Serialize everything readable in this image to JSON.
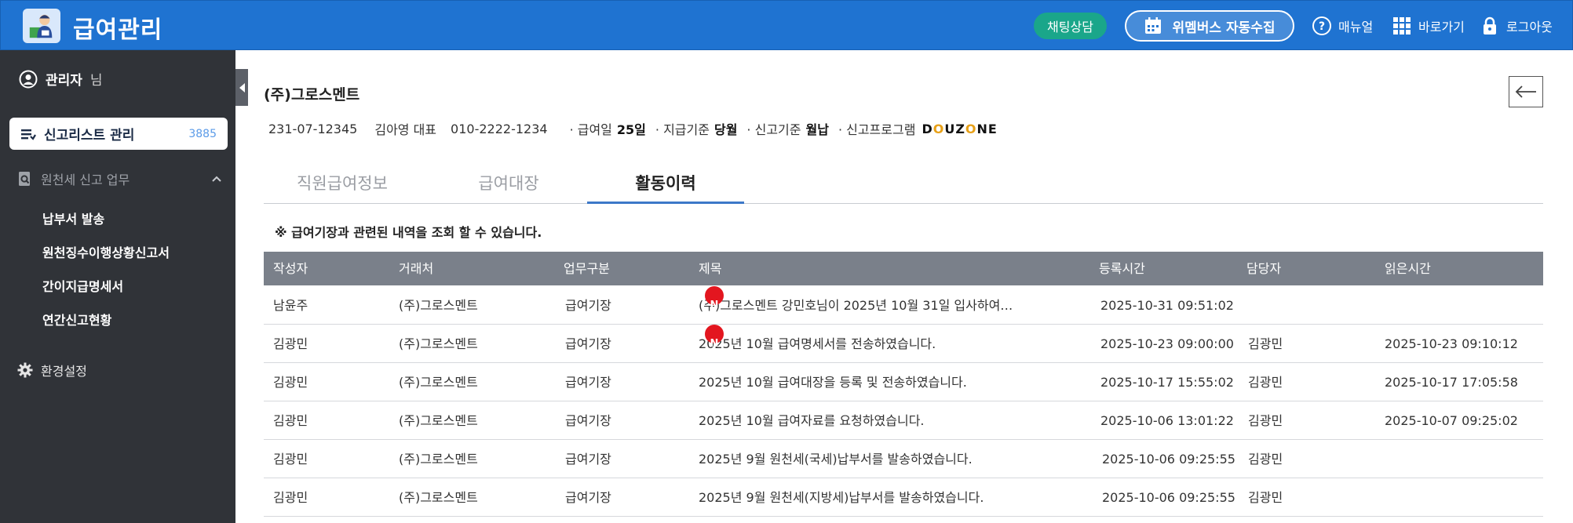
{
  "header": {
    "app_title": "급여관리",
    "chat_button": "채팅상담",
    "collect_button": "위멤버스 자동수집",
    "manual_link": "매뉴얼",
    "shortcut_link": "바로가기",
    "logout_link": "로그아웃",
    "brand_color": "#1f73d1"
  },
  "sidebar": {
    "admin_name": "관리자",
    "admin_suffix": "님",
    "active_menu": {
      "label": "신고리스트 관리",
      "count": "3885"
    },
    "section": {
      "label": "원천세 신고 업무",
      "expanded": true
    },
    "sub_items": [
      "납부서 발송",
      "원천징수이행상황신고서",
      "간이지급명세서",
      "연간신고현황"
    ],
    "settings": "환경설정"
  },
  "company": {
    "name": "(주)그로스멘트",
    "biz_no": "231-07-12345",
    "ceo": "김아영 대표",
    "phone": "010-2222-1234",
    "pay_day_label": "· 급여일",
    "pay_day_value": "25일",
    "pay_basis_label": "· 지급기준",
    "pay_basis_value": "당월",
    "report_basis_label": "· 신고기준",
    "report_basis_value": "월납",
    "program_label": "· 신고프로그램",
    "program_value": "DOUZONE"
  },
  "tabs": [
    {
      "label": "직원급여정보",
      "active": false
    },
    {
      "label": "급여대장",
      "active": false
    },
    {
      "label": "활동이력",
      "active": true
    }
  ],
  "notice": "※ 급여기장과 관련된 내역을 조회 할 수 있습니다.",
  "table": {
    "columns": [
      "작성자",
      "거래처",
      "업무구분",
      "제목",
      "등록시간",
      "담당자",
      "읽은시간"
    ],
    "rows": [
      {
        "writer": "남윤주",
        "client": "(주)그로스멘트",
        "type": "급여기장",
        "title": "(주)그로스멘트 강민호님이 2025년 10월 31일 입사하여…",
        "new": "N",
        "registered": "2025-10-31 09:51:02",
        "manager": "",
        "read": ""
      },
      {
        "writer": "김광민",
        "client": "(주)그로스멘트",
        "type": "급여기장",
        "title": "2025년 10월 급여명세서를 전송하였습니다.",
        "new": "N",
        "registered": "2025-10-23 09:00:00",
        "manager": "김광민",
        "read": "2025-10-23 09:10:12"
      },
      {
        "writer": "김광민",
        "client": "(주)그로스멘트",
        "type": "급여기장",
        "title": "2025년 10월 급여대장을 등록 및 전송하였습니다.",
        "new": "",
        "registered": "2025-10-17 15:55:02",
        "manager": "김광민",
        "read": "2025-10-17 17:05:58"
      },
      {
        "writer": "김광민",
        "client": "(주)그로스멘트",
        "type": "급여기장",
        "title": "2025년 10월 급여자료를 요청하였습니다.",
        "new": "",
        "registered": "2025-10-06 13:01:22",
        "manager": "김광민",
        "read": "2025-10-07 09:25:02"
      },
      {
        "writer": "김광민",
        "client": "(주)그로스멘트",
        "type": "급여기장",
        "title": "2025년 9월 원천세(국세)납부서를 발송하였습니다.",
        "new": "",
        "registered": "2025-10-06 09:25:55",
        "manager": "김광민",
        "read": ""
      },
      {
        "writer": "김광민",
        "client": "(주)그로스멘트",
        "type": "급여기장",
        "title": "2025년 9월 원천세(지방세)납부서를 발송하였습니다.",
        "new": "",
        "registered": "2025-10-06 09:25:55",
        "manager": "김광민",
        "read": ""
      }
    ]
  }
}
